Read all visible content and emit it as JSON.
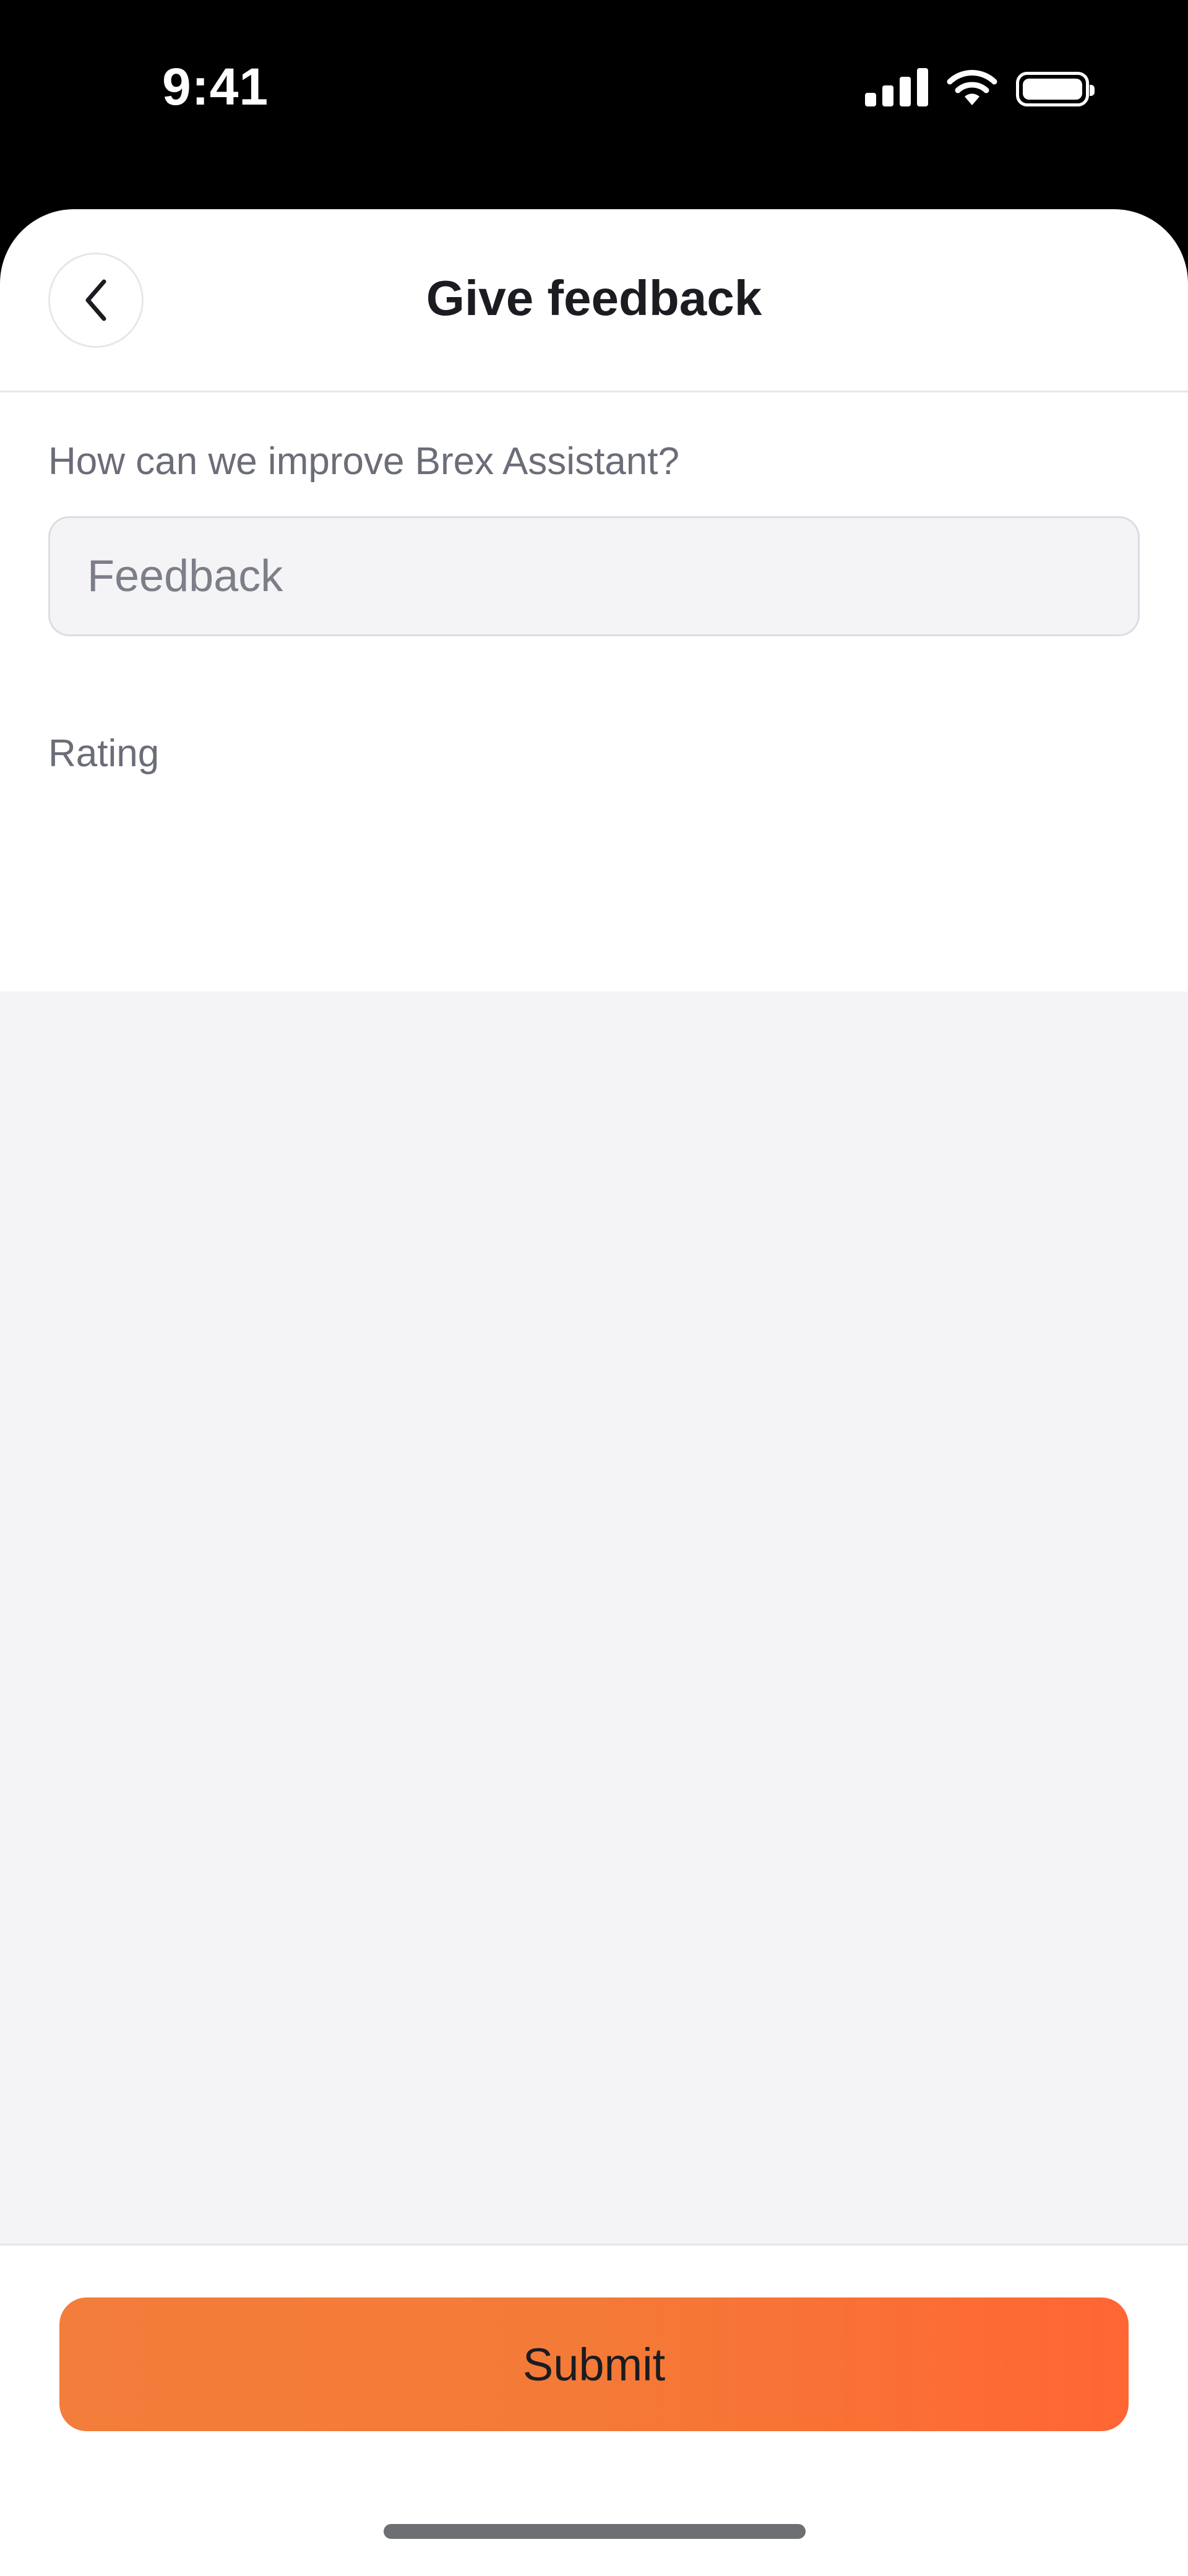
{
  "status_bar": {
    "time": "9:41",
    "signal_icon": "cellular-signal-icon",
    "wifi_icon": "wifi-icon",
    "battery_icon": "battery-icon"
  },
  "header": {
    "back_icon": "chevron-left-icon",
    "title": "Give feedback"
  },
  "form": {
    "feedback_label": "How can we improve Brex Assistant?",
    "feedback_placeholder": "Feedback",
    "feedback_value": "",
    "rating_label": "Rating",
    "rating": {
      "value": 0,
      "max": 5,
      "icon": "star-outline-icon"
    }
  },
  "footer": {
    "submit_label": "Submit"
  },
  "colors": {
    "accent_start": "#f37d3a",
    "accent_end": "#ff6633",
    "star_outline": "#c4c5cf",
    "background_muted": "#f4f4f7"
  }
}
